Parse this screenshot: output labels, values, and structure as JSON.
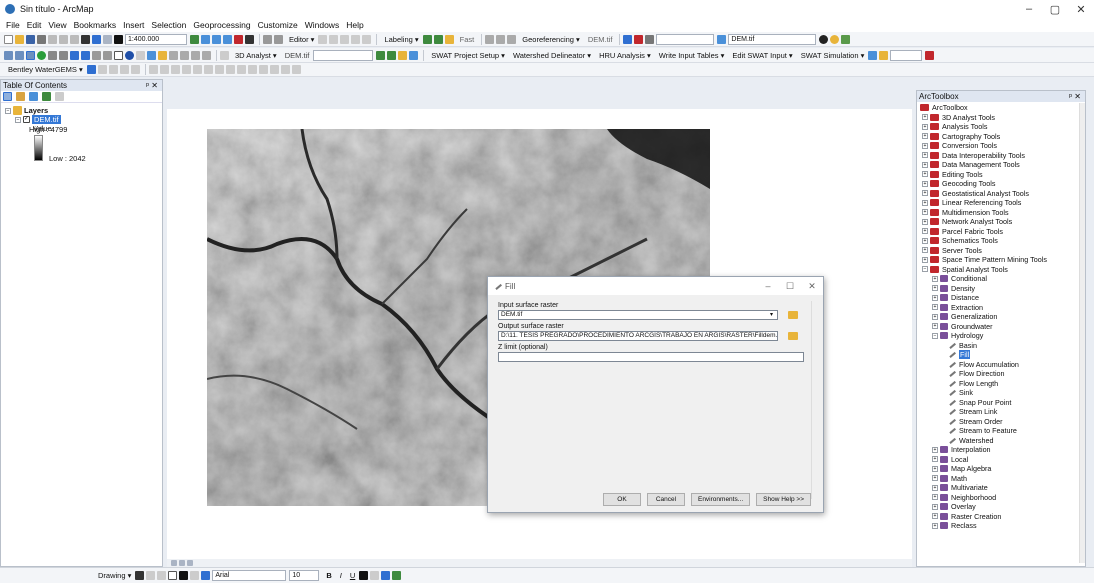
{
  "window": {
    "title": "Sin título - ArcMap",
    "controls": [
      "–",
      "▢",
      "✕"
    ]
  },
  "menu": [
    "File",
    "Edit",
    "View",
    "Bookmarks",
    "Insert",
    "Selection",
    "Geoprocessing",
    "Customize",
    "Windows",
    "Help"
  ],
  "toolbar1": {
    "scale": "1:400.000",
    "editor": "Editor ▾",
    "labeling": "Labeling ▾",
    "georeferencing": "Georeferencing ▾",
    "georef_layer": "DEM.tif",
    "fast": "Fast",
    "layer_select": "DEM.tif"
  },
  "toolbar2": {
    "analyst3d": "3D Analyst ▾",
    "analyst3d_layer": "DEM.tif",
    "swat_items": [
      "SWAT Project Setup ▾",
      "Watershed Delineator ▾",
      "HRU Analysis ▾",
      "Write Input Tables ▾",
      "Edit SWAT Input ▾",
      "SWAT Simulation ▾"
    ]
  },
  "toolbar3": {
    "bentley": "Bentley WaterGEMS ▾"
  },
  "toc": {
    "title": "Table Of Contents",
    "close": "ᵖ ✕",
    "layers_label": "Layers",
    "layer_name": "DEM.tif",
    "value_label": "Value",
    "high": "High : 4799",
    "low": "Low : 2042"
  },
  "dialog": {
    "title": "Fill",
    "controls": [
      "–",
      "☐",
      "✕"
    ],
    "input_label": "Input surface raster",
    "input_value": "DEM.tif",
    "output_label": "Output surface raster",
    "output_value": "D:\\11. TESIS PREGRADO\\PROCEDIMIENTO ARCGIS\\TRABAJO EN ARGIS\\RASTER\\Filldem.TIF",
    "zlimit_label": "Z limit (optional)",
    "zlimit_value": "",
    "buttons": {
      "ok": "OK",
      "cancel": "Cancel",
      "environments": "Environments...",
      "showhelp": "Show Help >>"
    }
  },
  "arctoolbox": {
    "title": "ArcToolbox",
    "close": "ᵖ ✕",
    "root": "ArcToolbox",
    "toolboxes": [
      "3D Analyst Tools",
      "Analysis Tools",
      "Cartography Tools",
      "Conversion Tools",
      "Data Interoperability Tools",
      "Data Management Tools",
      "Editing Tools",
      "Geocoding Tools",
      "Geostatistical Analyst Tools",
      "Linear Referencing Tools",
      "Multidimension Tools",
      "Network Analyst Tools",
      "Parcel Fabric Tools",
      "Schematics Tools",
      "Server Tools",
      "Space Time Pattern Mining Tools",
      "Spatial Analyst Tools"
    ],
    "spatial_sets_before": [
      "Conditional",
      "Density",
      "Distance",
      "Extraction",
      "Generalization",
      "Groundwater"
    ],
    "hydrology": "Hydrology",
    "hydro_tools": [
      "Basin",
      "Fill",
      "Flow Accumulation",
      "Flow Direction",
      "Flow Length",
      "Sink",
      "Snap Pour Point",
      "Stream Link",
      "Stream Order",
      "Stream to Feature",
      "Watershed"
    ],
    "spatial_sets_after": [
      "Interpolation",
      "Local",
      "Map Algebra",
      "Math",
      "Multivariate",
      "Neighborhood",
      "Overlay",
      "Raster Creation",
      "Reclass"
    ]
  },
  "drawing": {
    "label": "Drawing ▾",
    "font": "Arial",
    "size": "10",
    "b": "B",
    "i": "I",
    "u": "U"
  },
  "colors": {
    "accent": "#2f6fd1",
    "selection": "#3478d6",
    "toolbox_red": "#c1272d"
  }
}
